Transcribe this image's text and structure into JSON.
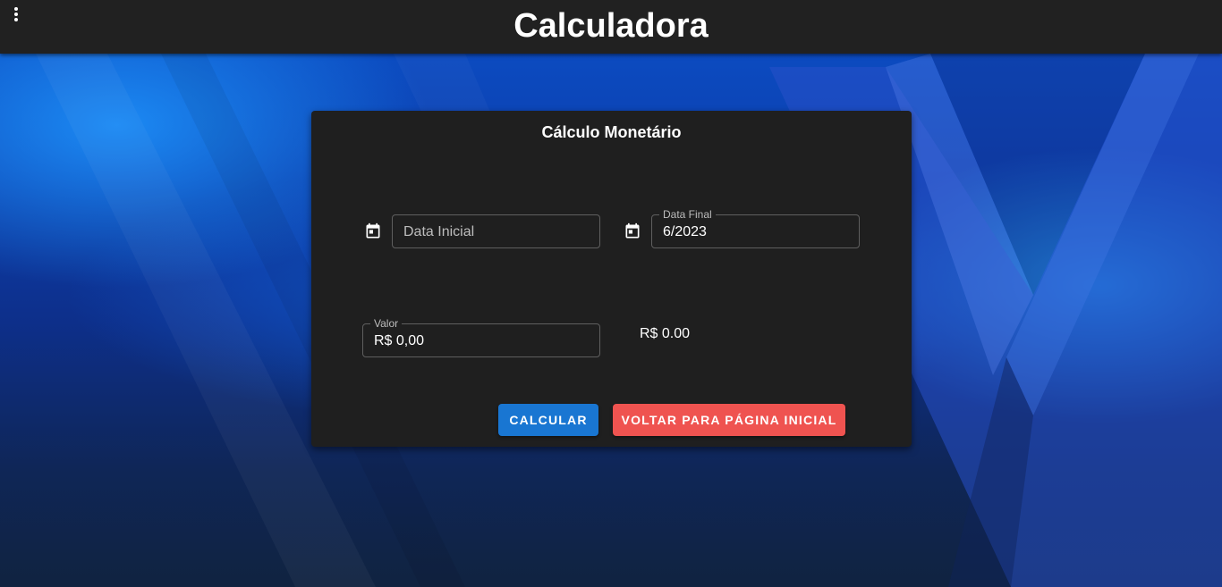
{
  "header": {
    "title": "Calculadora",
    "menu_icon": "dots-vertical-icon"
  },
  "card": {
    "title": "Cálculo Monetário",
    "start_date": {
      "icon": "calendar-icon",
      "label": "",
      "placeholder": "Data Inicial",
      "value": ""
    },
    "end_date": {
      "icon": "calendar-icon",
      "label": "Data Final",
      "value": "6/2023"
    },
    "amount": {
      "label": "Valor",
      "value": "R$ 0,00"
    },
    "result": "R$ 0.00",
    "buttons": {
      "calculate": "CALCULAR",
      "back_home": "VOLTAR PARA PÁGINA INICIAL"
    }
  },
  "colors": {
    "topbar": "#212121",
    "card": "#1f1f1f",
    "calculate_button": "#1976d2",
    "back_button": "#ef5350"
  }
}
